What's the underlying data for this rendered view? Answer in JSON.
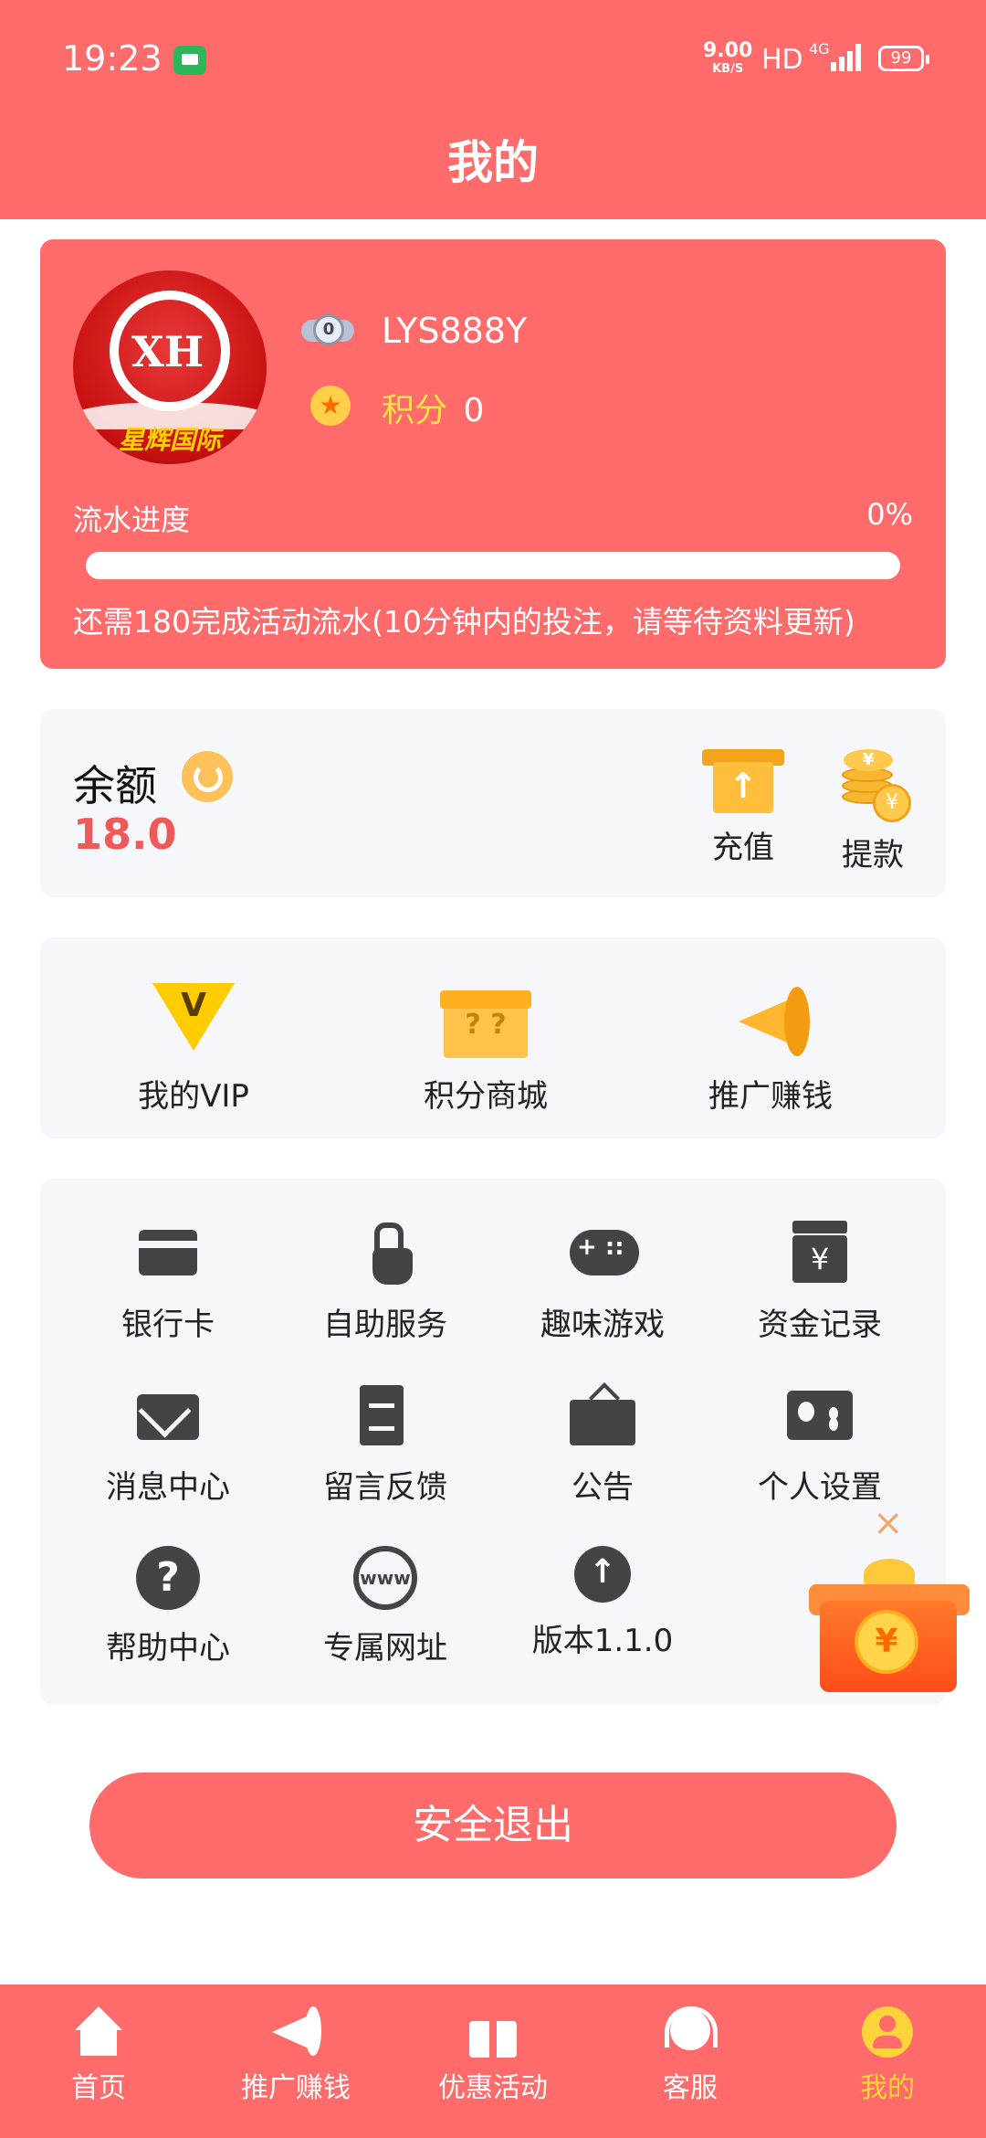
{
  "status_bar": {
    "time": "19:23",
    "speed_value": "9.00",
    "speed_unit": "KB/S",
    "hd": "HD",
    "network": "4G",
    "battery": "99"
  },
  "header": {
    "title": "我的"
  },
  "profile": {
    "avatar_text": "XH",
    "avatar_caption": "星辉国际",
    "level": "0",
    "username": "LYS888Y",
    "points_label": "积分",
    "points_value": "0",
    "flow_label": "流水进度",
    "flow_percent": "0%",
    "flow_progress": 0,
    "flow_note": "还需180完成活动流水(10分钟内的投注，请等待资料更新)"
  },
  "balance": {
    "label": "余额",
    "value": "18.0",
    "recharge_label": "充值",
    "withdraw_label": "提款",
    "coin_symbol": "¥"
  },
  "vip_row": {
    "items": [
      {
        "label": "我的VIP",
        "icon": "vip-diamond-icon"
      },
      {
        "label": "积分商城",
        "icon": "gift-box-icon"
      },
      {
        "label": "推广赚钱",
        "icon": "megaphone-icon"
      }
    ]
  },
  "grid": {
    "items": [
      {
        "label": "银行卡",
        "icon": "bank-card-icon"
      },
      {
        "label": "自助服务",
        "icon": "tap-hand-icon"
      },
      {
        "label": "趣味游戏",
        "icon": "gamepad-icon"
      },
      {
        "label": "资金记录",
        "icon": "fund-record-icon"
      },
      {
        "label": "消息中心",
        "icon": "mail-icon"
      },
      {
        "label": "留言反馈",
        "icon": "feedback-doc-icon"
      },
      {
        "label": "公告",
        "icon": "notice-board-icon"
      },
      {
        "label": "个人设置",
        "icon": "id-card-icon"
      },
      {
        "label": "帮助中心",
        "icon": "help-icon"
      },
      {
        "label": "专属网址",
        "icon": "www-globe-icon"
      },
      {
        "label": "版本1.1.0",
        "icon": "upload-icon"
      }
    ]
  },
  "floating_gift": {
    "close_symbol": "×",
    "coin_symbol": "¥"
  },
  "logout": {
    "label": "安全退出"
  },
  "bottom_nav": {
    "items": [
      {
        "label": "首页",
        "icon": "home-icon"
      },
      {
        "label": "推广赚钱",
        "icon": "megaphone-icon"
      },
      {
        "label": "优惠活动",
        "icon": "gift-icon"
      },
      {
        "label": "客服",
        "icon": "headset-icon"
      },
      {
        "label": "我的",
        "icon": "user-icon",
        "active": true
      }
    ]
  },
  "colors": {
    "primary": "#ff6b6b",
    "balance_value": "#f0595a",
    "active_tab": "#ffd43b",
    "points": "#ffe14a"
  }
}
